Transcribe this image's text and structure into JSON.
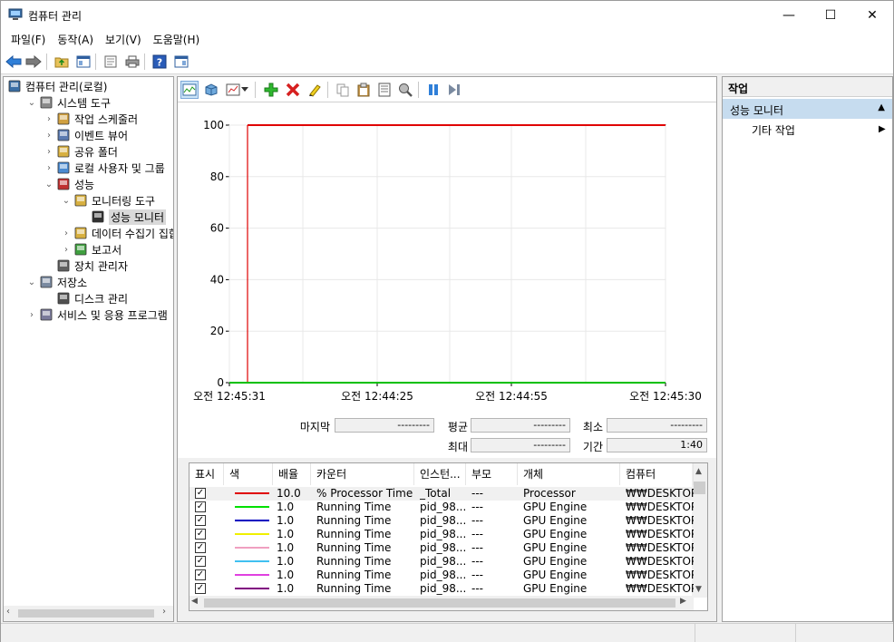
{
  "window": {
    "title": "컴퓨터 관리",
    "min": "—",
    "max": "☐",
    "close": "✕"
  },
  "menu": [
    "파일(F)",
    "동작(A)",
    "보기(V)",
    "도움말(H)"
  ],
  "tree": [
    {
      "label": "컴퓨터 관리(로컬)",
      "depth": 0,
      "chev": "",
      "icon": "computer-management-icon"
    },
    {
      "label": "시스템 도구",
      "depth": 1,
      "chev": "v",
      "icon": "system-tools-icon"
    },
    {
      "label": "작업 스케줄러",
      "depth": 2,
      "chev": ">",
      "icon": "task-scheduler-icon"
    },
    {
      "label": "이벤트 뷰어",
      "depth": 2,
      "chev": ">",
      "icon": "event-viewer-icon"
    },
    {
      "label": "공유 폴더",
      "depth": 2,
      "chev": ">",
      "icon": "shared-folders-icon"
    },
    {
      "label": "로컬 사용자 및 그룹",
      "depth": 2,
      "chev": ">",
      "icon": "local-users-icon"
    },
    {
      "label": "성능",
      "depth": 2,
      "chev": "v",
      "icon": "performance-icon"
    },
    {
      "label": "모니터링 도구",
      "depth": 3,
      "chev": "v",
      "icon": "monitoring-tools-icon"
    },
    {
      "label": "성능 모니터",
      "depth": 4,
      "chev": "",
      "icon": "performance-monitor-icon",
      "selected": true
    },
    {
      "label": "데이터 수집기 집합",
      "depth": 3,
      "chev": ">",
      "icon": "data-collector-icon"
    },
    {
      "label": "보고서",
      "depth": 3,
      "chev": ">",
      "icon": "reports-icon"
    },
    {
      "label": "장치 관리자",
      "depth": 2,
      "chev": "",
      "icon": "device-manager-icon"
    },
    {
      "label": "저장소",
      "depth": 1,
      "chev": "v",
      "icon": "storage-icon"
    },
    {
      "label": "디스크 관리",
      "depth": 2,
      "chev": "",
      "icon": "disk-management-icon"
    },
    {
      "label": "서비스 및 응용 프로그램",
      "depth": 1,
      "chev": ">",
      "icon": "services-icon"
    }
  ],
  "graph": {
    "y_ticks": [
      "100",
      "80",
      "60",
      "40",
      "20",
      "0"
    ],
    "x_ticks": [
      "오전 12:45:31",
      "오전 12:44:25",
      "오전 12:44:55",
      "오전 12:45:30"
    ]
  },
  "chart_data": {
    "type": "line",
    "ylim": [
      0,
      100
    ],
    "yticks": [
      100,
      80,
      60,
      40,
      20,
      0
    ],
    "xticks": [
      "오전 12:45:31",
      "오전 12:44:25",
      "오전 12:44:55",
      "오전 12:45:30"
    ],
    "grid": true,
    "series": [
      {
        "name": "% Processor Time",
        "color": "#e00000",
        "y_sampled": [
          100,
          100,
          100,
          100,
          100,
          100
        ]
      },
      {
        "name": "Running Time",
        "color": "#00c000",
        "y_sampled": [
          0,
          0,
          0,
          0,
          0,
          0
        ]
      }
    ]
  },
  "stats": {
    "last_label": "마지막",
    "last_value": "---------",
    "avg_label": "평균",
    "avg_value": "---------",
    "min_label": "최소",
    "min_value": "---------",
    "max_label": "최대",
    "max_value": "---------",
    "duration_label": "기간",
    "duration_value": "1:40"
  },
  "counter_headers": [
    "표시",
    "색",
    "배율",
    "카운터",
    "인스턴...",
    "부모",
    "개체",
    "컴퓨터"
  ],
  "counters": [
    {
      "check": "✓",
      "color": "#e00000",
      "scale": "10.0",
      "counter": "% Processor Time",
      "instance": "_Total",
      "parent": "---",
      "object": "Processor",
      "computer": "₩₩DESKTOP-"
    },
    {
      "check": "✓",
      "color": "#00e000",
      "scale": "1.0",
      "counter": "Running Time",
      "instance": "pid_98...",
      "parent": "---",
      "object": "GPU Engine",
      "computer": "₩₩DESKTOP-"
    },
    {
      "check": "✓",
      "color": "#0000c0",
      "scale": "1.0",
      "counter": "Running Time",
      "instance": "pid_98...",
      "parent": "---",
      "object": "GPU Engine",
      "computer": "₩₩DESKTOP-"
    },
    {
      "check": "✓",
      "color": "#f0f000",
      "scale": "1.0",
      "counter": "Running Time",
      "instance": "pid_98...",
      "parent": "---",
      "object": "GPU Engine",
      "computer": "₩₩DESKTOP-"
    },
    {
      "check": "✓",
      "color": "#f0a0c0",
      "scale": "1.0",
      "counter": "Running Time",
      "instance": "pid_98...",
      "parent": "---",
      "object": "GPU Engine",
      "computer": "₩₩DESKTOP-"
    },
    {
      "check": "✓",
      "color": "#40c0f0",
      "scale": "1.0",
      "counter": "Running Time",
      "instance": "pid_98...",
      "parent": "---",
      "object": "GPU Engine",
      "computer": "₩₩DESKTOP-"
    },
    {
      "check": "✓",
      "color": "#e040e0",
      "scale": "1.0",
      "counter": "Running Time",
      "instance": "pid_98...",
      "parent": "---",
      "object": "GPU Engine",
      "computer": "₩₩DESKTOP-"
    },
    {
      "check": "✓",
      "color": "#800080",
      "scale": "1.0",
      "counter": "Running Time",
      "instance": "pid_98...",
      "parent": "---",
      "object": "GPU Engine",
      "computer": "₩₩DESKTOP-"
    }
  ],
  "actions": {
    "header": "작업",
    "section": "성능 모니터",
    "section_arrow": "▲",
    "item": "기타 작업",
    "item_arrow": "▶"
  }
}
